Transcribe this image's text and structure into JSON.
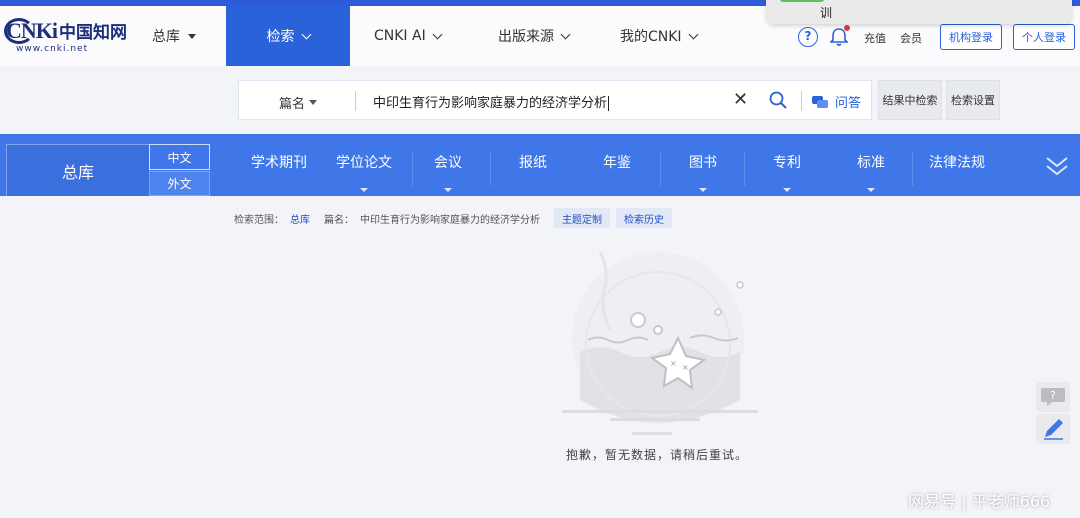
{
  "notification": {
    "text": "训"
  },
  "header": {
    "logo": {
      "cn": "中国知网",
      "brand": "CNKi",
      "url": "www.cnki.net"
    },
    "nav": {
      "zongku": "总库",
      "search": "检索",
      "cnki_ai": "CNKI AI",
      "source": "出版来源",
      "my_cnki": "我的CNKI"
    },
    "recharge": "充值",
    "member": "会员",
    "org_login": "机构登录",
    "personal_login": "个人登录"
  },
  "search": {
    "field": "篇名",
    "query": "中印生育行为影响家庭暴力的经济学分析",
    "qa_label": "问答",
    "search_in_results": "结果中检索",
    "search_settings": "检索设置"
  },
  "categories": {
    "zongku": "总库",
    "chinese": "中文",
    "foreign": "外文",
    "items": [
      "学术期刊",
      "学位论文",
      "会议",
      "报纸",
      "年鉴",
      "图书",
      "专利",
      "标准",
      "法律法规"
    ]
  },
  "results": {
    "scope_label": "检索范围：",
    "scope_value": "总库",
    "query_label": "篇名：",
    "query_value": "中印生育行为影响家庭暴力的经济学分析",
    "topic_custom": "主题定制",
    "history": "检索历史",
    "empty_message": "抱歉，暂无数据，请稍后重试。"
  },
  "watermark": "网易号 | 平老师666",
  "colors": {
    "primary": "#2a62d9",
    "catbar": "#3f77e8",
    "notif_green": "#5cc05c"
  }
}
